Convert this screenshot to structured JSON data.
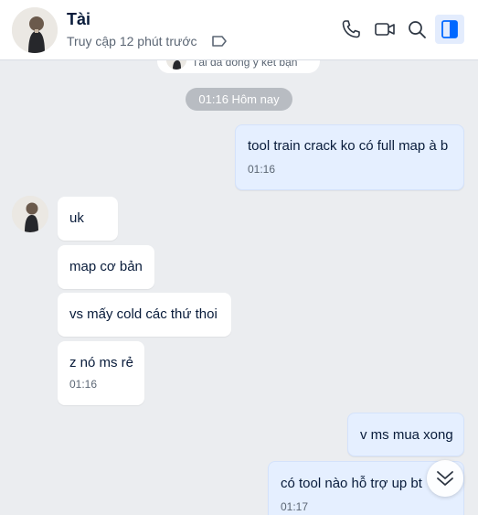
{
  "header": {
    "name": "Tài",
    "status": "Truy cập 12 phút trước",
    "icons": [
      "phone-icon",
      "video-call-icon",
      "search-icon",
      "conversation-info-icon"
    ]
  },
  "system": {
    "notice": "Tài đã đồng ý kết bạn",
    "date_chip": "01:16 Hôm nay"
  },
  "messages": [
    {
      "side": "out",
      "text": "tool train crack ko có full map à b",
      "time": "01:16"
    },
    {
      "side": "in",
      "text": "uk",
      "time": ""
    },
    {
      "side": "in",
      "text": "map cơ bản",
      "time": ""
    },
    {
      "side": "in",
      "text": "vs mấy cold các thứ thoi",
      "time": ""
    },
    {
      "side": "in",
      "text": "z nó ms rẻ",
      "time": "01:16"
    },
    {
      "side": "out",
      "text": "v ms mua xong",
      "time": ""
    },
    {
      "side": "out",
      "text": "có tool nào hỗ trợ up bt",
      "time": "01:17"
    }
  ],
  "colors": {
    "accent": "#0068ff",
    "chat_bg": "#ebedf0",
    "outgoing_bubble": "#e5efff",
    "incoming_bubble": "#ffffff"
  }
}
